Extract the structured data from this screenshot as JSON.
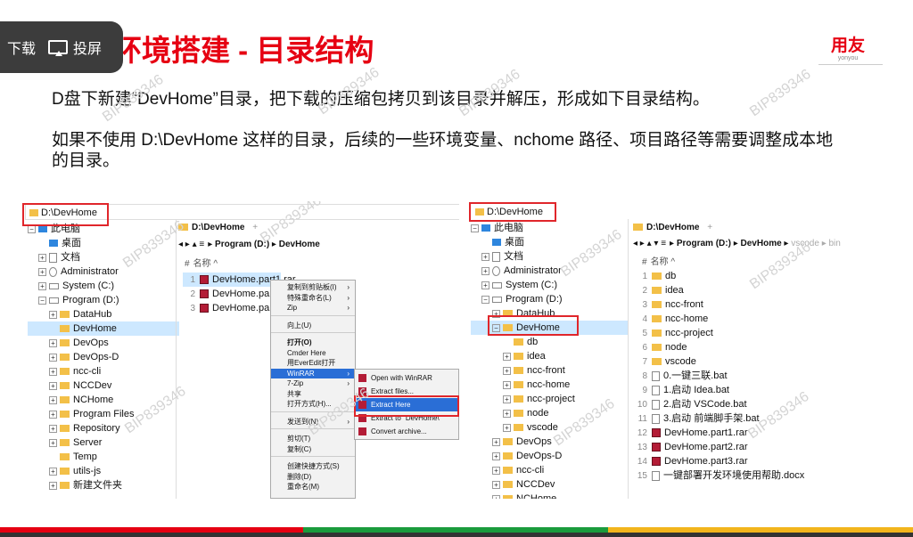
{
  "overlay": {
    "download": "下载",
    "cast": "投屏"
  },
  "title": "一键环境搭建 - 目录结构",
  "logo": {
    "name": "用友",
    "sub": "yonyou"
  },
  "paragraph1": "D盘下新建“DevHome”目录，把下载的压缩包拷贝到该目录并解压，形成如下目录结构。",
  "paragraph2": "如果不使用 D:\\DevHome 这样的目录，后续的一些环境变量、nchome 路径、项目路径等需要调整成本地的目录。",
  "watermark": "BIP839346",
  "left": {
    "address": "D:\\DevHome",
    "tree": [
      {
        "label": "此电脑",
        "icon": "pc",
        "indent": 0,
        "exp": "−"
      },
      {
        "label": "桌面",
        "icon": "desktop",
        "indent": 1,
        "exp": ""
      },
      {
        "label": "文档",
        "icon": "doc",
        "indent": 1,
        "exp": "+"
      },
      {
        "label": "Administrator",
        "icon": "user",
        "indent": 1,
        "exp": "+"
      },
      {
        "label": "System (C:)",
        "icon": "drive",
        "indent": 1,
        "exp": "+"
      },
      {
        "label": "Program (D:)",
        "icon": "drive",
        "indent": 1,
        "exp": "−"
      },
      {
        "label": "DataHub",
        "icon": "folder",
        "indent": 2,
        "exp": "+"
      },
      {
        "label": "DevHome",
        "icon": "folder",
        "indent": 2,
        "exp": "",
        "selected": true
      },
      {
        "label": "DevOps",
        "icon": "folder",
        "indent": 2,
        "exp": "+"
      },
      {
        "label": "DevOps-D",
        "icon": "folder",
        "indent": 2,
        "exp": "+"
      },
      {
        "label": "ncc-cli",
        "icon": "folder",
        "indent": 2,
        "exp": "+"
      },
      {
        "label": "NCCDev",
        "icon": "folder",
        "indent": 2,
        "exp": "+"
      },
      {
        "label": "NCHome",
        "icon": "folder",
        "indent": 2,
        "exp": "+"
      },
      {
        "label": "Program Files",
        "icon": "folder",
        "indent": 2,
        "exp": "+"
      },
      {
        "label": "Repository",
        "icon": "folder",
        "indent": 2,
        "exp": "+"
      },
      {
        "label": "Server",
        "icon": "folder",
        "indent": 2,
        "exp": "+"
      },
      {
        "label": "Temp",
        "icon": "folder",
        "indent": 2,
        "exp": ""
      },
      {
        "label": "utils-js",
        "icon": "folder",
        "indent": 2,
        "exp": "+"
      },
      {
        "label": "新建文件夹",
        "icon": "folder",
        "indent": 2,
        "exp": "+"
      }
    ],
    "tab": "D:\\DevHome",
    "tab_plus": "+",
    "breadcrumb": "▸ Program (D:) ▸ DevHome",
    "col_header": "名称",
    "files": [
      {
        "n": "1",
        "name": "DevHome.part1.rar"
      },
      {
        "n": "2",
        "name": "DevHome.part2.rar"
      },
      {
        "n": "3",
        "name": "DevHome.part3.rar"
      }
    ],
    "context_menu": [
      {
        "label": "复制到剪贴板(I)",
        "arrow": "›"
      },
      {
        "label": "特殊重命名(L)",
        "arrow": "›"
      },
      {
        "label": "Zip",
        "arrow": "›"
      },
      {
        "label": "",
        "arrow": ""
      },
      {
        "label": "向上(U)",
        "arrow": ""
      },
      {
        "label": "",
        "arrow": ""
      },
      {
        "label": "打开(O)",
        "arrow": "",
        "bold": true
      },
      {
        "label": "Cmder Here",
        "arrow": ""
      },
      {
        "label": "用EverEdit打开",
        "arrow": ""
      },
      {
        "label": "WinRAR",
        "arrow": "›",
        "hl": true
      },
      {
        "label": "7-Zip",
        "arrow": "›"
      },
      {
        "label": "共享",
        "arrow": ""
      },
      {
        "label": "打开方式(H)...",
        "arrow": ""
      },
      {
        "label": "",
        "arrow": ""
      },
      {
        "label": "发送到(N)",
        "arrow": "›"
      },
      {
        "label": "",
        "arrow": ""
      },
      {
        "label": "剪切(T)",
        "arrow": ""
      },
      {
        "label": "复制(C)",
        "arrow": ""
      },
      {
        "label": "",
        "arrow": ""
      },
      {
        "label": "创建快捷方式(S)",
        "arrow": ""
      },
      {
        "label": "删除(D)",
        "arrow": ""
      },
      {
        "label": "重命名(M)",
        "arrow": ""
      }
    ],
    "submenu": [
      {
        "label": "Open with WinRAR"
      },
      {
        "label": "Extract files..."
      },
      {
        "label": "Extract Here",
        "hl": true
      },
      {
        "label": "Extract to \"DevHome\\\""
      },
      {
        "label": "Convert archive..."
      }
    ]
  },
  "right": {
    "address": "D:\\DevHome",
    "tree": [
      {
        "label": "此电脑",
        "icon": "pc",
        "indent": 0,
        "exp": "−"
      },
      {
        "label": "桌面",
        "icon": "desktop",
        "indent": 1,
        "exp": ""
      },
      {
        "label": "文档",
        "icon": "doc",
        "indent": 1,
        "exp": "+"
      },
      {
        "label": "Administrator",
        "icon": "user",
        "indent": 1,
        "exp": "+"
      },
      {
        "label": "System (C:)",
        "icon": "drive",
        "indent": 1,
        "exp": "+"
      },
      {
        "label": "Program (D:)",
        "icon": "drive",
        "indent": 1,
        "exp": "−"
      },
      {
        "label": "DataHub",
        "icon": "folder",
        "indent": 2,
        "exp": "+"
      },
      {
        "label": "DevHome",
        "icon": "folder",
        "indent": 2,
        "exp": "−",
        "selected": true
      },
      {
        "label": "db",
        "icon": "folder",
        "indent": 3,
        "exp": ""
      },
      {
        "label": "idea",
        "icon": "folder",
        "indent": 3,
        "exp": "+"
      },
      {
        "label": "ncc-front",
        "icon": "folder",
        "indent": 3,
        "exp": "+"
      },
      {
        "label": "ncc-home",
        "icon": "folder",
        "indent": 3,
        "exp": "+"
      },
      {
        "label": "ncc-project",
        "icon": "folder",
        "indent": 3,
        "exp": "+"
      },
      {
        "label": "node",
        "icon": "folder",
        "indent": 3,
        "exp": "+"
      },
      {
        "label": "vscode",
        "icon": "folder",
        "indent": 3,
        "exp": "+"
      },
      {
        "label": "DevOps",
        "icon": "folder",
        "indent": 2,
        "exp": "+"
      },
      {
        "label": "DevOps-D",
        "icon": "folder",
        "indent": 2,
        "exp": "+"
      },
      {
        "label": "ncc-cli",
        "icon": "folder",
        "indent": 2,
        "exp": "+"
      },
      {
        "label": "NCCDev",
        "icon": "folder",
        "indent": 2,
        "exp": "+"
      },
      {
        "label": "NCHome",
        "icon": "folder",
        "indent": 2,
        "exp": "+"
      }
    ],
    "tab": "D:\\DevHome",
    "tab_plus": "+",
    "breadcrumb": "▸ Program (D:) ▸ DevHome ▸",
    "breadcrumb_faded": "vscode ▸ bin",
    "col_header": "名称",
    "files": [
      {
        "n": "1",
        "name": "db",
        "icon": "folder"
      },
      {
        "n": "2",
        "name": "idea",
        "icon": "folder"
      },
      {
        "n": "3",
        "name": "ncc-front",
        "icon": "folder"
      },
      {
        "n": "4",
        "name": "ncc-home",
        "icon": "folder"
      },
      {
        "n": "5",
        "name": "ncc-project",
        "icon": "folder"
      },
      {
        "n": "6",
        "name": "node",
        "icon": "folder"
      },
      {
        "n": "7",
        "name": "vscode",
        "icon": "folder"
      },
      {
        "n": "8",
        "name": "0.一键三联.bat",
        "icon": "bat"
      },
      {
        "n": "9",
        "name": "1.启动 Idea.bat",
        "icon": "bat"
      },
      {
        "n": "10",
        "name": "2.启动 VSCode.bat",
        "icon": "bat"
      },
      {
        "n": "11",
        "name": "3.启动 前端脚手架.bat",
        "icon": "bat"
      },
      {
        "n": "12",
        "name": "DevHome.part1.rar",
        "icon": "rar"
      },
      {
        "n": "13",
        "name": "DevHome.part2.rar",
        "icon": "rar"
      },
      {
        "n": "14",
        "name": "DevHome.part3.rar",
        "icon": "rar"
      },
      {
        "n": "15",
        "name": "一键部署开发环境使用帮助.docx",
        "icon": "docx"
      }
    ]
  },
  "colors": {
    "red": "#e60012",
    "green": "#1a9b3c",
    "yellow": "#f2b51c",
    "dark": "#333333"
  }
}
